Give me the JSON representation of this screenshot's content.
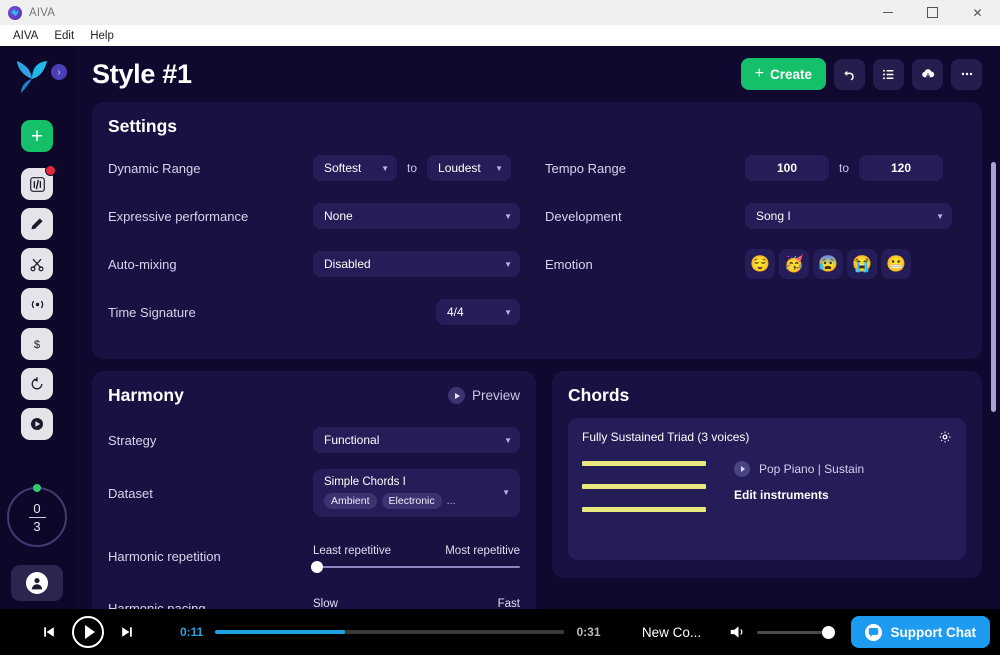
{
  "window": {
    "title": "AIVA",
    "controls": {
      "minimize": "minimize-button",
      "maximize": "maximize-button",
      "close": "close-button"
    }
  },
  "menubar": {
    "items": [
      "AIVA",
      "Edit",
      "Help"
    ]
  },
  "sidebar": {
    "logo": "aiva-logo",
    "expand": "›",
    "buttons": [
      {
        "name": "create-new",
        "icon": "plus-icon",
        "badge": false
      },
      {
        "name": "my-tracks",
        "icon": "waveform-icon",
        "badge": true
      },
      {
        "name": "edit",
        "icon": "pencil-icon",
        "badge": false
      },
      {
        "name": "cut",
        "icon": "scissors-icon",
        "badge": false
      },
      {
        "name": "broadcast",
        "icon": "radio-waves-icon",
        "badge": false
      },
      {
        "name": "pricing",
        "icon": "dollar-icon",
        "badge": false
      },
      {
        "name": "history",
        "icon": "history-icon",
        "badge": false
      },
      {
        "name": "play-library",
        "icon": "play-icon",
        "badge": false
      }
    ],
    "credits": {
      "used": "0",
      "total": "3"
    },
    "account": "account-avatar"
  },
  "header": {
    "title": "Style #1",
    "create_label": "Create",
    "create_plus": "+",
    "actions": [
      {
        "name": "undo-button",
        "icon": "undo-arrow-icon"
      },
      {
        "name": "list-view-button",
        "icon": "list-icon"
      },
      {
        "name": "download-button",
        "icon": "cloud-download-icon"
      },
      {
        "name": "more-options-button",
        "icon": "ellipsis-icon"
      }
    ]
  },
  "settings": {
    "title": "Settings",
    "dynamic_range": {
      "label": "Dynamic Range",
      "from": "Softest",
      "to_word": "to",
      "to": "Loudest"
    },
    "expressive_performance": {
      "label": "Expressive performance",
      "value": "None"
    },
    "auto_mixing": {
      "label": "Auto-mixing",
      "value": "Disabled"
    },
    "time_signature": {
      "label": "Time Signature",
      "value": "4/4"
    },
    "tempo_range": {
      "label": "Tempo Range",
      "from": "100",
      "to_word": "to",
      "to": "120"
    },
    "development": {
      "label": "Development",
      "value": "Song I"
    },
    "emotion": {
      "label": "Emotion",
      "options": [
        {
          "name": "emotion-relieved",
          "glyph": "😌"
        },
        {
          "name": "emotion-partying",
          "glyph": "🥳"
        },
        {
          "name": "emotion-anxious",
          "glyph": "😰"
        },
        {
          "name": "emotion-crying",
          "glyph": "😭"
        },
        {
          "name": "emotion-grimacing",
          "glyph": "😬"
        }
      ]
    }
  },
  "harmony": {
    "title": "Harmony",
    "preview_label": "Preview",
    "strategy": {
      "label": "Strategy",
      "value": "Functional"
    },
    "dataset": {
      "label": "Dataset",
      "value": "Simple Chords I",
      "tags": [
        "Ambient",
        "Electronic"
      ],
      "more": "..."
    },
    "harmonic_repetition": {
      "label": "Harmonic repetition",
      "min_label": "Least repetitive",
      "max_label": "Most repetitive",
      "position_percent": 0
    },
    "harmonic_pacing": {
      "label": "Harmonic pacing",
      "min_label": "Slow",
      "max_label": "Fast"
    }
  },
  "chords": {
    "title": "Chords",
    "item": {
      "name": "Fully Sustained Triad (3 voices)",
      "voices": 3,
      "instrument": "Pop Piano | Sustain",
      "edit_link": "Edit instruments",
      "settings_icon": "gear-icon"
    }
  },
  "player": {
    "prev": "previous-track",
    "play": "play-button",
    "next": "next-track",
    "current_time": "0:11",
    "duration": "0:31",
    "progress_percent": 37,
    "track_name": "New Co...",
    "volume_percent": 100,
    "support_label": "Support Chat"
  },
  "colors": {
    "accent_green": "#14c06a",
    "accent_blue": "#1d9bf0",
    "card_bg": "#191141",
    "page_bg": "#0f0930",
    "control_bg": "#241d58",
    "note_bar": "#e8ea7e"
  }
}
